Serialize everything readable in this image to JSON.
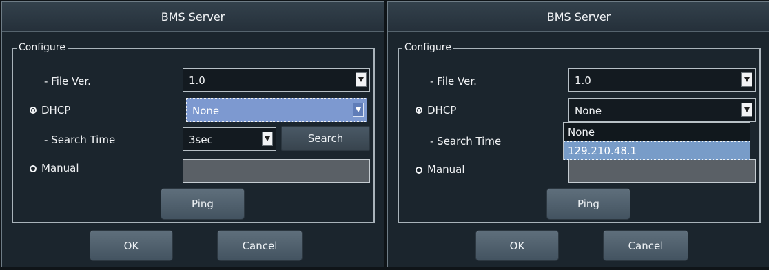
{
  "dialogs": {
    "left": {
      "title": "BMS Server",
      "configure": "Configure",
      "file_ver_label": "- File Ver.",
      "file_ver_value": "1.0",
      "dhcp_label": "DHCP",
      "dhcp_value": "None",
      "search_time_label": "- Search Time",
      "search_time_value": "3sec",
      "search_button": "Search",
      "manual_label": "Manual",
      "ping_button": "Ping",
      "ok_button": "OK",
      "cancel_button": "Cancel"
    },
    "right": {
      "title": "BMS Server",
      "configure": "Configure",
      "file_ver_label": "- File Ver.",
      "file_ver_value": "1.0",
      "dhcp_label": "DHCP",
      "dhcp_value": "None",
      "search_time_label": "- Search Time",
      "manual_label": "Manual",
      "ping_button": "Ping",
      "ok_button": "OK",
      "cancel_button": "Cancel",
      "dropdown_options": [
        "None",
        "129.210.48.1"
      ]
    }
  },
  "colors": {
    "background": "#1b252d",
    "highlight": "#7d99d0",
    "list_selected": "#789cc8"
  }
}
